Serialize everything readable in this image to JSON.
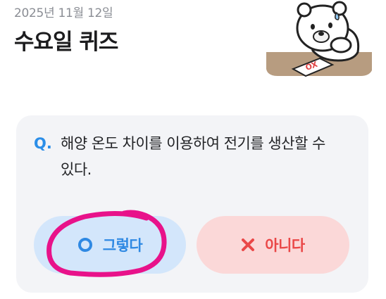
{
  "header": {
    "date": "2025년 11월 12일",
    "title": "수요일 퀴즈"
  },
  "illustration": {
    "sheet_text": "OX"
  },
  "quiz": {
    "prefix": "Q.",
    "question": "해양 온도 차이를 이용하여 전기를 생산할 수 있다."
  },
  "answers": {
    "yes_label": "그렇다",
    "yes_icon": "circle-o-icon",
    "no_label": "아니다",
    "no_icon": "x-icon"
  },
  "colors": {
    "accent_blue": "#2f89e3",
    "yes_bg": "#d3e6fb",
    "accent_red": "#ea4747",
    "no_bg": "#fbd8d8",
    "annotation": "#e8128a"
  }
}
